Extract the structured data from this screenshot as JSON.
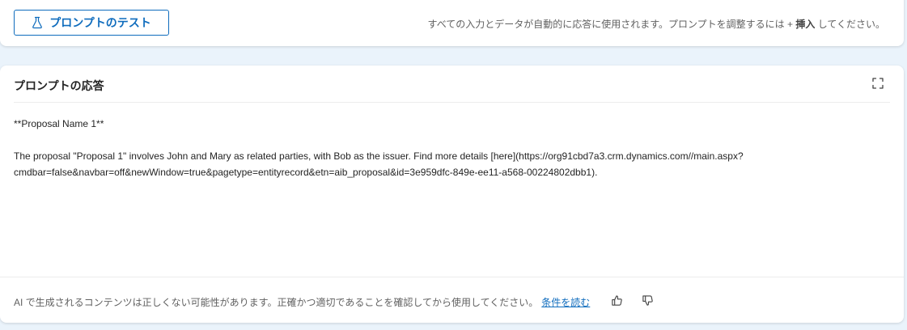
{
  "top": {
    "test_button_label": "プロンプトのテスト",
    "hint_prefix": "すべての入力とデータが自動的に応答に使用されます。プロンプトを調整するには + ",
    "hint_bold": "挿入",
    "hint_suffix": " してください。"
  },
  "response": {
    "title": "プロンプトの応答",
    "line1": "**Proposal Name 1**",
    "line2": "The proposal \"Proposal 1\" involves John and Mary as related parties, with Bob as the issuer. Find more details [here](https://org91cbd7a3.crm.dynamics.com//main.aspx?",
    "line3": "cmdbar=false&navbar=off&newWindow=true&pagetype=entityrecord&etn=aib_proposal&id=3e959dfc-849e-ee11-a568-00224802dbb1)."
  },
  "footer": {
    "disclaimer": "AI で生成されるコンテンツは正しくない可能性があります。正確かつ適切であることを確認してから使用してください。",
    "terms_link": "条件を読む"
  },
  "icons": {
    "test": "flask-icon",
    "expand": "expand-icon",
    "like": "thumbs-up-icon",
    "dislike": "thumbs-down-icon"
  },
  "colors": {
    "accent": "#0f6cbd",
    "background": "#eaf3fb",
    "card": "#ffffff"
  }
}
